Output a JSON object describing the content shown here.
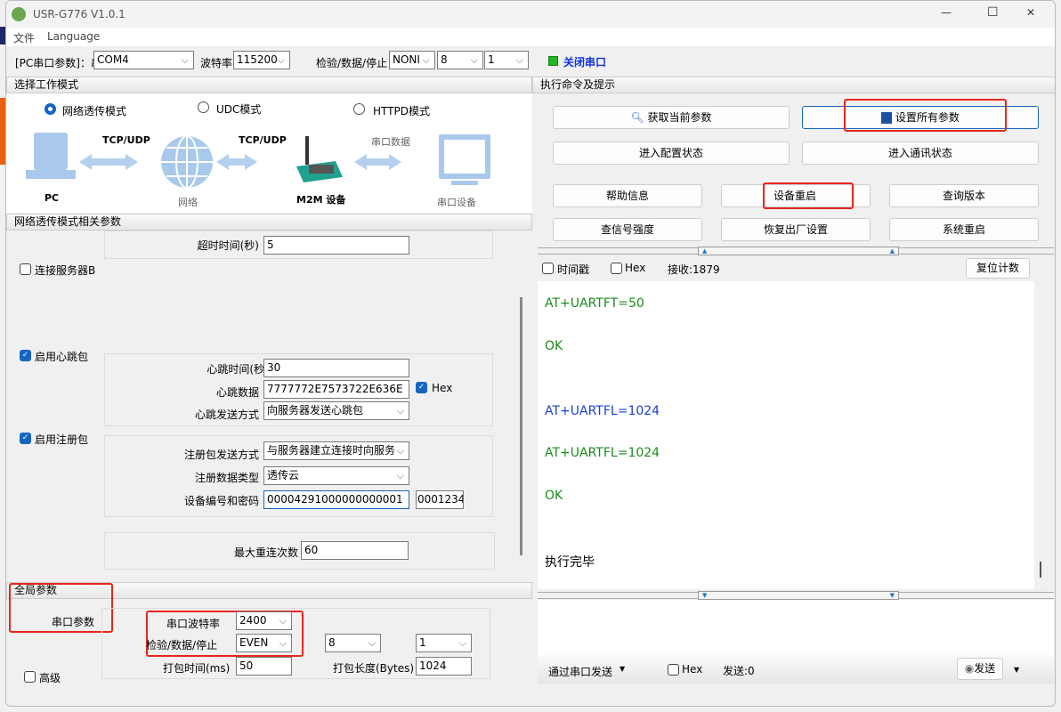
{
  "window": {
    "title": "USR-G776 V1.0.1",
    "minimize": "—",
    "maximize": "☐",
    "close": "✕"
  },
  "menu": [
    "文件",
    "Language"
  ],
  "toolbar": {
    "pc_label": "[PC串口参数]：串口号",
    "port": "COM4",
    "baud_label": "波特率",
    "baud": "115200",
    "parity_label": "检验/数据/停止",
    "parity": "NONI",
    "data_bits": "8",
    "stop_bits": "1",
    "close_port": "关闭串口",
    "status_color": "#22b822"
  },
  "mode": {
    "section": "选择工作模式",
    "options": [
      "网络透传模式",
      "UDC模式",
      "HTTPD模式"
    ],
    "selected": 0,
    "diagram": {
      "link1": "TCP/UDP",
      "link2": "TCP/UDP",
      "link3": "串口数据",
      "pc": "PC",
      "net": "网络",
      "m2m": "M2M 设备",
      "serial": "串口设备"
    }
  },
  "params": {
    "section": "网络透传模式相关参数",
    "timeout_label": "超时时间(秒)",
    "timeout": "5",
    "server_b": "连接服务器B",
    "heartbeat": {
      "enable": "启用心跳包",
      "time_label": "心跳时间(秒",
      "time": "30",
      "data_label": "心跳数据",
      "data": "7777772E7573722E636E",
      "hex": "Hex",
      "mode_label": "心跳发送方式",
      "mode": "向服务器发送心跳包"
    },
    "register": {
      "enable": "启用注册包",
      "mode_label": "注册包发送方式",
      "mode": "与服务器建立连接时向服务",
      "type_label": "注册数据类型",
      "type": "透传云",
      "id_label": "设备编号和密码",
      "id": "00004291000000000001",
      "pwd": "0001234"
    },
    "retry_label": "最大重连次数",
    "retry": "60"
  },
  "global": {
    "section": "全局参数",
    "serial_label": "串口参数",
    "baud_label": "串口波特率",
    "baud": "2400",
    "parity_label": "检验/数据/停止",
    "parity": "EVEN",
    "data_bits": "8",
    "stop_bits": "1",
    "pack_time_label": "打包时间(ms)",
    "pack_time": "50",
    "pack_len_label": "打包长度(Bytes)",
    "pack_len": "1024",
    "advanced": "高级"
  },
  "commands": {
    "section": "执行命令及提示",
    "get_params": "获取当前参数",
    "set_params": "设置所有参数",
    "enter_config": "进入配置状态",
    "enter_comm": "进入通讯状态",
    "help": "帮助信息",
    "restart_device": "设备重启",
    "query_version": "查询版本",
    "signal": "查信号强度",
    "factory_reset": "恢复出厂设置",
    "system_restart": "系统重启"
  },
  "receive": {
    "timestamp": "时间戳",
    "hex": "Hex",
    "count": "接收:1879",
    "reset": "复位计数",
    "log": [
      {
        "text": "AT+UARTFT=50",
        "color": "#1a8c1a"
      },
      {
        "text": "OK",
        "color": "#1a8c1a"
      },
      {
        "text": "AT+UARTFL=1024",
        "color": "#1a3fd8"
      },
      {
        "text": "AT+UARTFL=1024",
        "color": "#1a8c1a"
      },
      {
        "text": "OK",
        "color": "#1a8c1a"
      },
      {
        "text": "执行完毕",
        "color": "#000000"
      }
    ]
  },
  "send": {
    "via": "通过串口发送",
    "hex": "Hex",
    "count": "发送:0",
    "send": "发送"
  }
}
